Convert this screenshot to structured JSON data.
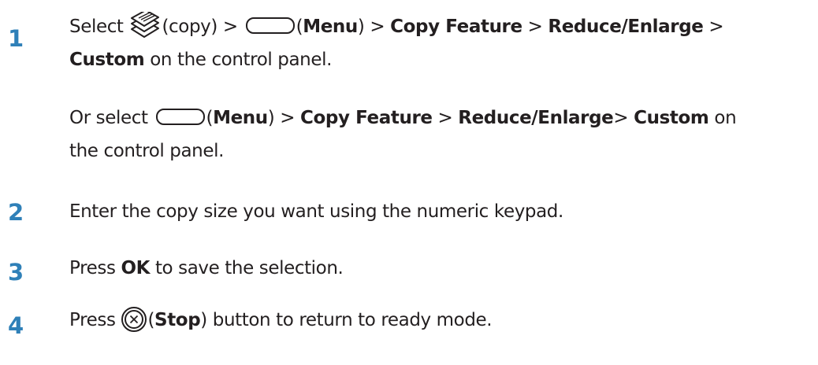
{
  "steps": [
    {
      "number": "1",
      "line1": {
        "t_select": "Select ",
        "copy_icon_label": "(copy) > ",
        "menu_open": "(",
        "menu": "Menu",
        "menu_close": ") > ",
        "copy_feature": "Copy Feature",
        "sep1": " > ",
        "reduce_enlarge": "Reduce/Enlarge",
        "sep2": " >"
      },
      "line2": {
        "custom": "Custom",
        "rest": " on the control panel."
      },
      "line3": {
        "t_or_select": "Or select ",
        "menu_open": "(",
        "menu": "Menu",
        "menu_close": ") > ",
        "copy_feature": "Copy Feature",
        "sep1": " > ",
        "reduce_enlarge": "Reduce/Enlarge",
        "sep2": "> ",
        "custom": "Custom",
        "on": " on"
      },
      "line4": "the control panel."
    },
    {
      "number": "2",
      "text": "Enter the copy size you want using the numeric keypad."
    },
    {
      "number": "3",
      "t_press": "Press ",
      "ok": "OK",
      "rest": " to save the selection."
    },
    {
      "number": "4",
      "t_press": "Press ",
      "paren_open": "(",
      "stop": "Stop",
      "rest": ") button to return to ready mode."
    }
  ],
  "icons": [
    "copy-icon",
    "menu-button-icon",
    "stop-button-icon"
  ]
}
